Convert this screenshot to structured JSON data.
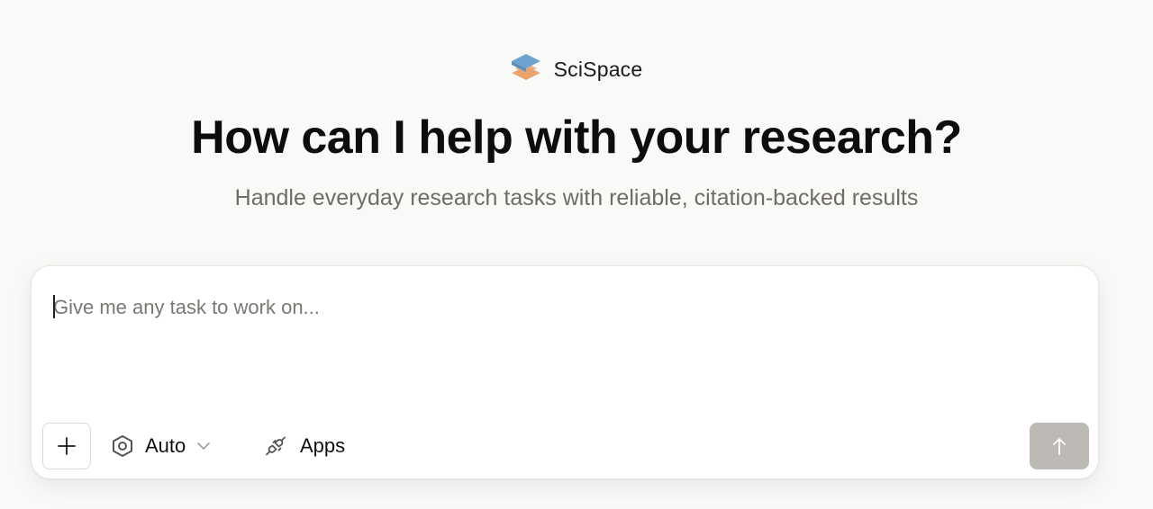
{
  "brand": {
    "logo_icon": "scispace-logo-icon",
    "name": "SciSpace"
  },
  "hero": {
    "title": "How can I help with your research?",
    "subtitle": "Handle everyday research tasks with reliable, citation-backed results"
  },
  "composer": {
    "input_value": "",
    "input_placeholder": "Give me any task to work on...",
    "add_button_icon": "plus-icon",
    "mode": {
      "icon": "hexagon-icon",
      "selected_label": "Auto",
      "chevron_icon": "chevron-down-icon"
    },
    "apps": {
      "icon": "plug-icon",
      "label": "Apps"
    },
    "send_button_icon": "arrow-up-icon"
  },
  "colors": {
    "background": "#f9f9f8",
    "logo_blue": "#6fa3cf",
    "logo_orange": "#eba26b",
    "subtitle_text": "#6f6b67",
    "send_button_disabled": "#bdbab6"
  }
}
